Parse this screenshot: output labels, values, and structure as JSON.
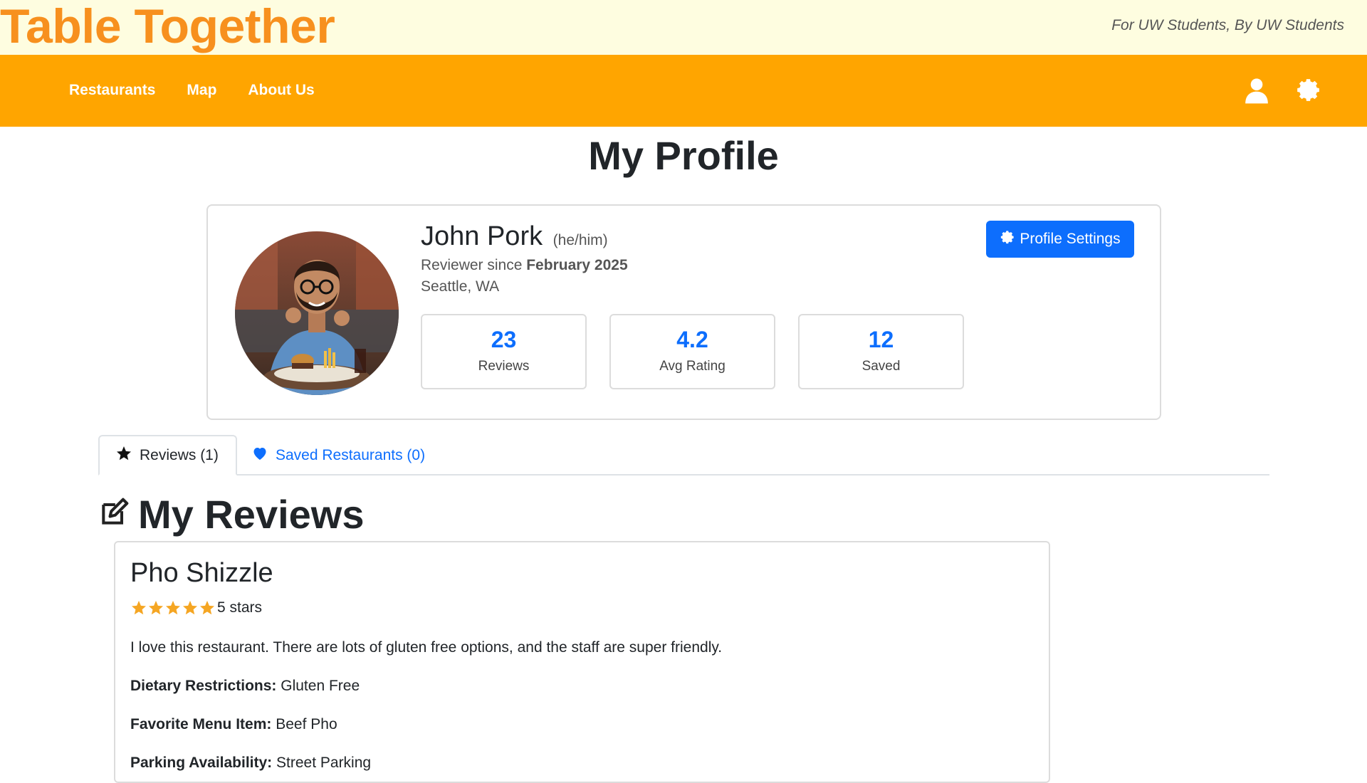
{
  "brand": {
    "title": "Table Together",
    "tagline": "For UW Students, By UW Students",
    "colors": {
      "brand_orange": "#f7901e",
      "nav_orange": "#ffa500",
      "accent_blue": "#0d6efd"
    }
  },
  "nav": {
    "links": [
      "Restaurants",
      "Map",
      "About Us"
    ],
    "icons": [
      "user-icon",
      "gear-icon"
    ]
  },
  "page": {
    "title": "My Profile"
  },
  "profile": {
    "name": "John Pork",
    "pronouns": "(he/him)",
    "reviewer_since_prefix": "Reviewer since",
    "reviewer_since_date": "February 2025",
    "location": "Seattle, WA",
    "settings_button": "Profile Settings",
    "stats": [
      {
        "value": "23",
        "label": "Reviews"
      },
      {
        "value": "4.2",
        "label": "Avg Rating"
      },
      {
        "value": "12",
        "label": "Saved"
      }
    ]
  },
  "tabs": [
    {
      "label": "Reviews (1)",
      "icon": "star-icon",
      "active": true
    },
    {
      "label": "Saved Restaurants (0)",
      "icon": "heart-icon",
      "active": false
    }
  ],
  "reviews_section": {
    "heading": "My Reviews",
    "items": [
      {
        "restaurant": "Pho Shizzle",
        "rating": 5,
        "rating_text": "5 stars",
        "text": "I love this restaurant. There are lots of gluten free options, and the staff are super friendly.",
        "fields": [
          {
            "label": "Dietary Restrictions:",
            "value": "Gluten Free"
          },
          {
            "label": "Favorite Menu Item:",
            "value": "Beef Pho"
          },
          {
            "label": "Parking Availability:",
            "value": "Street Parking"
          }
        ]
      }
    ]
  }
}
